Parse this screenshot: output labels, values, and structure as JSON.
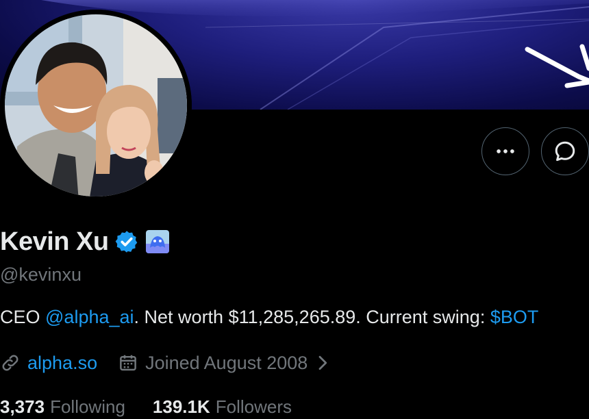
{
  "profile": {
    "display_name": "Kevin Xu",
    "handle": "@kevinxu",
    "bio": {
      "prefix": "CEO ",
      "mention": "@alpha_ai",
      "middle": ". Net worth $11,285,265.89. Current swing: ",
      "cashtag": "$BOT"
    },
    "website": "alpha.so",
    "joined": "Joined August 2008",
    "following_count": "3,373",
    "following_label": "Following",
    "followers_count": "139.1K",
    "followers_label": "Followers"
  },
  "icons": {
    "more": "more-horizontal-icon",
    "message": "message-icon",
    "verified": "verified-badge-icon",
    "affiliation": "affiliation-badge-icon",
    "link": "link-icon",
    "calendar": "calendar-icon",
    "chevron": "chevron-right-icon"
  },
  "colors": {
    "background": "#000000",
    "accent": "#1d9bf0",
    "secondary_text": "#71767b",
    "primary_text": "#e7e9ea"
  }
}
